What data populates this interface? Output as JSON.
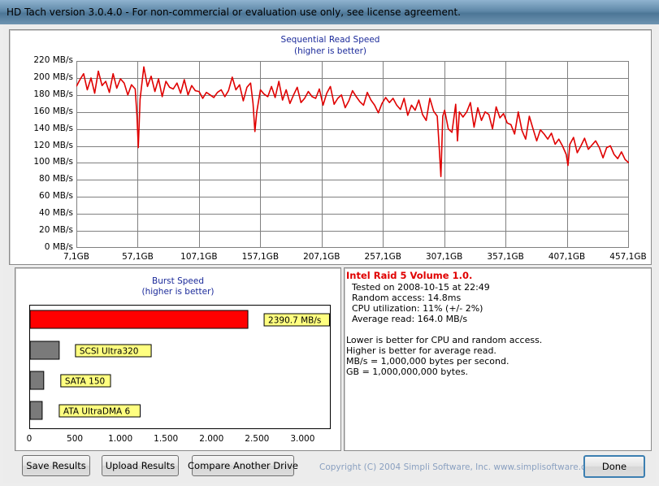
{
  "window": {
    "title": "HD Tach version 3.0.4.0  - For non-commercial or evaluation use only, see license agreement."
  },
  "read_chart": {
    "title": "Sequential Read Speed",
    "subtitle": "(higher is better)",
    "y_ticks": [
      "0 MB/s",
      "20 MB/s",
      "40 MB/s",
      "60 MB/s",
      "80 MB/s",
      "100 MB/s",
      "120 MB/s",
      "140 MB/s",
      "160 MB/s",
      "180 MB/s",
      "200 MB/s",
      "220 MB/s"
    ],
    "x_ticks": [
      "7,1GB",
      "57,1GB",
      "107,1GB",
      "157,1GB",
      "207,1GB",
      "257,1GB",
      "307,1GB",
      "357,1GB",
      "407,1GB",
      "457,1GB"
    ]
  },
  "burst_chart": {
    "title": "Burst Speed",
    "subtitle": "(higher is better)",
    "x_ticks": [
      "0",
      "500",
      "1.000",
      "1.500",
      "2.000",
      "2.500",
      "3.000"
    ]
  },
  "chart_data": [
    {
      "type": "line",
      "title": "Sequential Read Speed",
      "subtitle": "(higher is better)",
      "xlabel": "",
      "ylabel": "",
      "x_unit": "GB",
      "y_unit": "MB/s",
      "xlim": [
        7.1,
        457.1
      ],
      "ylim": [
        0,
        220
      ],
      "grid": true,
      "series": [
        {
          "color": "#e00000",
          "x": [
            7.1,
            10,
            13,
            16,
            19,
            22,
            25,
            28,
            31,
            34,
            37,
            40,
            43,
            46,
            49,
            52,
            55,
            56.5,
            57.5,
            59,
            62,
            65,
            68,
            71,
            74,
            77,
            80,
            83,
            86,
            89,
            92,
            95,
            98,
            101,
            104,
            107,
            110,
            113,
            116,
            119,
            122,
            125,
            128,
            131,
            134,
            137,
            140,
            143,
            146,
            149,
            151,
            152.5,
            154,
            157,
            160,
            163,
            166,
            169,
            172,
            175,
            178,
            181,
            184,
            187,
            190,
            193,
            196,
            199,
            202,
            205,
            208,
            211,
            214,
            217,
            220,
            223,
            226,
            229,
            232,
            235,
            238,
            241,
            244,
            247,
            250,
            253,
            256,
            259,
            262,
            265,
            268,
            271,
            274,
            277,
            280,
            283,
            286,
            289,
            292,
            295,
            298,
            301,
            302.5,
            304,
            305.5,
            307,
            310,
            313,
            316,
            317.5,
            319,
            322,
            325,
            328,
            331,
            334,
            337,
            340,
            343,
            346,
            349,
            352,
            355,
            358,
            361,
            364,
            367,
            370,
            373,
            376,
            379,
            382,
            385,
            388,
            391,
            394,
            397,
            400,
            403,
            406,
            407.5,
            409,
            412,
            415,
            418,
            421,
            424,
            427,
            430,
            433,
            436,
            439,
            442,
            445,
            448,
            451,
            454,
            457.1
          ],
          "y": [
            190,
            198,
            205,
            186,
            200,
            182,
            208,
            191,
            196,
            183,
            205,
            188,
            199,
            194,
            180,
            192,
            187,
            155,
            118,
            175,
            213,
            190,
            202,
            184,
            199,
            178,
            196,
            189,
            187,
            194,
            182,
            198,
            180,
            191,
            185,
            184,
            176,
            183,
            180,
            177,
            183,
            186,
            178,
            185,
            201,
            186,
            192,
            173,
            189,
            194,
            170,
            137,
            160,
            186,
            181,
            178,
            190,
            177,
            196,
            174,
            186,
            170,
            180,
            189,
            171,
            176,
            184,
            178,
            176,
            187,
            168,
            182,
            190,
            169,
            176,
            180,
            165,
            173,
            185,
            178,
            172,
            168,
            183,
            174,
            168,
            159,
            170,
            177,
            171,
            176,
            168,
            163,
            176,
            156,
            168,
            162,
            174,
            157,
            150,
            176,
            161,
            155,
            120,
            84,
            155,
            162,
            140,
            136,
            169,
            126,
            160,
            154,
            160,
            171,
            142,
            165,
            150,
            160,
            157,
            140,
            166,
            153,
            158,
            147,
            145,
            134,
            160,
            138,
            128,
            155,
            140,
            126,
            139,
            134,
            128,
            135,
            122,
            128,
            120,
            110,
            97,
            122,
            130,
            112,
            120,
            129,
            116,
            121,
            126,
            118,
            106,
            118,
            120,
            110,
            105,
            113,
            104,
            100
          ]
        }
      ]
    },
    {
      "type": "bar",
      "title": "Burst Speed",
      "subtitle": "(higher is better)",
      "orientation": "horizontal",
      "xlim": [
        0,
        3300
      ],
      "grid": false,
      "categories": [
        "Intel Raid 5 Volume 1.0.",
        "SCSI Ultra320",
        "SATA 150",
        "ATA UltraDMA 6"
      ],
      "values": [
        2390.7,
        320,
        150,
        133
      ],
      "bar_labels": [
        "2390.7 MB/s",
        "SCSI Ultra320",
        "SATA 150",
        "ATA UltraDMA 6"
      ],
      "colors": [
        "#ff0000",
        "#7a7a7a",
        "#7a7a7a",
        "#7a7a7a"
      ]
    }
  ],
  "info": {
    "drive_name": "Intel Raid 5 Volume 1.0.",
    "tested_on": "Tested on 2008-10-15 at 22:49",
    "random_access": "Random access: 14.8ms",
    "cpu_util": "CPU utilization: 11% (+/- 2%)",
    "avg_read": "Average read: 164.0 MB/s",
    "note1": "Lower is better for CPU and random access.",
    "note2": "Higher is better for average read.",
    "note3": "MB/s = 1,000,000 bytes per second.",
    "note4": "GB = 1,000,000,000 bytes."
  },
  "buttons": {
    "save": "Save Results",
    "upload": "Upload Results",
    "compare": "Compare Another Drive",
    "done": "Done"
  },
  "footer": {
    "copyright": "Copyright (C) 2004 Simpli Software, Inc. www.simplisoftware.com"
  }
}
